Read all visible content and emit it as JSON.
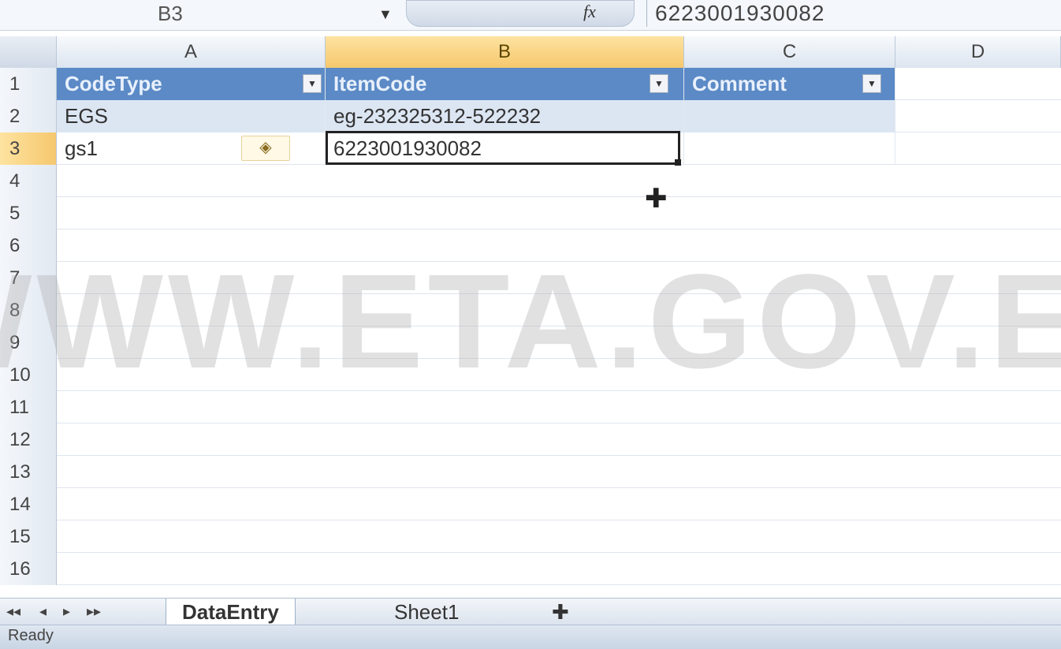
{
  "formula_bar": {
    "name_box": "B3",
    "fx_label": "fx",
    "content": "6223001930082"
  },
  "columns": [
    "A",
    "B",
    "C",
    "D"
  ],
  "rows": [
    "1",
    "2",
    "3",
    "4",
    "5",
    "6",
    "7",
    "8",
    "9",
    "10",
    "11",
    "12",
    "13",
    "14",
    "15",
    "16"
  ],
  "table": {
    "headers": [
      "CodeType",
      "ItemCode",
      "Comment"
    ],
    "data": [
      [
        "EGS",
        "eg-232325312-522232",
        ""
      ],
      [
        "gs1",
        "6223001930082",
        ""
      ]
    ]
  },
  "watermark": "WWW.ETA.GOV.EG",
  "sheets": [
    "DataEntry",
    "Sheet1"
  ],
  "status": "Ready",
  "icons": {
    "filter": "filter-dropdown-icon",
    "smart_tag": "smart-tag-icon",
    "cursor": "cell-cursor-icon",
    "new_sheet": "insert-sheet-icon"
  },
  "colors": {
    "header_fill": "#5b8ac6",
    "band_fill": "#dce6f3",
    "selected_header": "#f6c86e"
  }
}
